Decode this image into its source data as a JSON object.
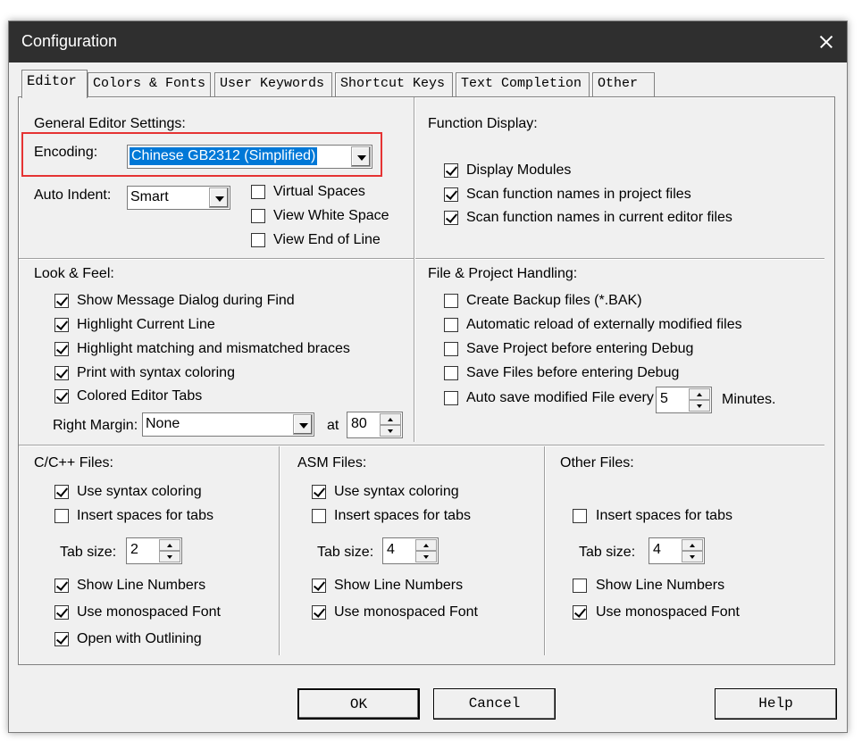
{
  "window": {
    "title": "Configuration"
  },
  "tabs": [
    "Editor",
    "Colors & Fonts",
    "User Keywords",
    "Shortcut Keys",
    "Text Completion",
    "Other"
  ],
  "general": {
    "title": "General Editor Settings:",
    "encoding_label": "Encoding:",
    "encoding_value": "Chinese GB2312 (Simplified)",
    "auto_indent_label": "Auto Indent:",
    "auto_indent_value": "Smart",
    "options": [
      {
        "label": "Virtual Spaces",
        "checked": false
      },
      {
        "label": "View White Space",
        "checked": false
      },
      {
        "label": "View End of Line",
        "checked": false
      }
    ]
  },
  "function_display": {
    "title": "Function Display:",
    "options": [
      {
        "label": "Display Modules",
        "checked": true
      },
      {
        "label": "Scan function names in project files",
        "checked": true
      },
      {
        "label": "Scan function names in current editor files",
        "checked": true
      }
    ]
  },
  "look_feel": {
    "title": "Look & Feel:",
    "options": [
      {
        "label": "Show Message Dialog during Find",
        "checked": true
      },
      {
        "label": "Highlight Current Line",
        "checked": true
      },
      {
        "label": "Highlight matching and mismatched braces",
        "checked": true
      },
      {
        "label": "Print with syntax coloring",
        "checked": true
      },
      {
        "label": "Colored Editor Tabs",
        "checked": true
      }
    ],
    "right_margin_label": "Right Margin:",
    "right_margin_value": "None",
    "at_label": "at",
    "at_value": "80"
  },
  "file_project": {
    "title": "File & Project Handling:",
    "options": [
      {
        "label": "Create Backup files (*.BAK)",
        "checked": false
      },
      {
        "label": "Automatic reload of externally modified files",
        "checked": false
      },
      {
        "label": "Save Project before entering Debug",
        "checked": false
      },
      {
        "label": "Save Files before entering Debug",
        "checked": false
      },
      {
        "label": "Auto save modified File every",
        "checked": false
      }
    ],
    "autosave_value": "5",
    "minutes_label": "Minutes."
  },
  "cpp_files": {
    "title": "C/C++ Files:",
    "use_syntax": {
      "label": "Use syntax coloring",
      "checked": true
    },
    "insert_spaces": {
      "label": "Insert spaces for tabs",
      "checked": false
    },
    "tab_size_label": "Tab size:",
    "tab_size": "2",
    "show_line_numbers": {
      "label": "Show Line Numbers",
      "checked": true
    },
    "monospaced": {
      "label": "Use monospaced Font",
      "checked": true
    },
    "outlining": {
      "label": "Open with Outlining",
      "checked": true
    }
  },
  "asm_files": {
    "title": "ASM Files:",
    "use_syntax": {
      "label": "Use syntax coloring",
      "checked": true
    },
    "insert_spaces": {
      "label": "Insert spaces for tabs",
      "checked": false
    },
    "tab_size_label": "Tab size:",
    "tab_size": "4",
    "show_line_numbers": {
      "label": "Show Line Numbers",
      "checked": true
    },
    "monospaced": {
      "label": "Use monospaced Font",
      "checked": true
    }
  },
  "other_files": {
    "title": "Other Files:",
    "insert_spaces": {
      "label": "Insert spaces for tabs",
      "checked": false
    },
    "tab_size_label": "Tab size:",
    "tab_size": "4",
    "show_line_numbers": {
      "label": "Show Line Numbers",
      "checked": false
    },
    "monospaced": {
      "label": "Use monospaced Font",
      "checked": true
    }
  },
  "buttons": {
    "ok": "OK",
    "cancel": "Cancel",
    "help": "Help"
  },
  "colors": {
    "titlebar": "#2f2f2f",
    "highlight_box": "#e53333",
    "selection": "#0078d7"
  }
}
